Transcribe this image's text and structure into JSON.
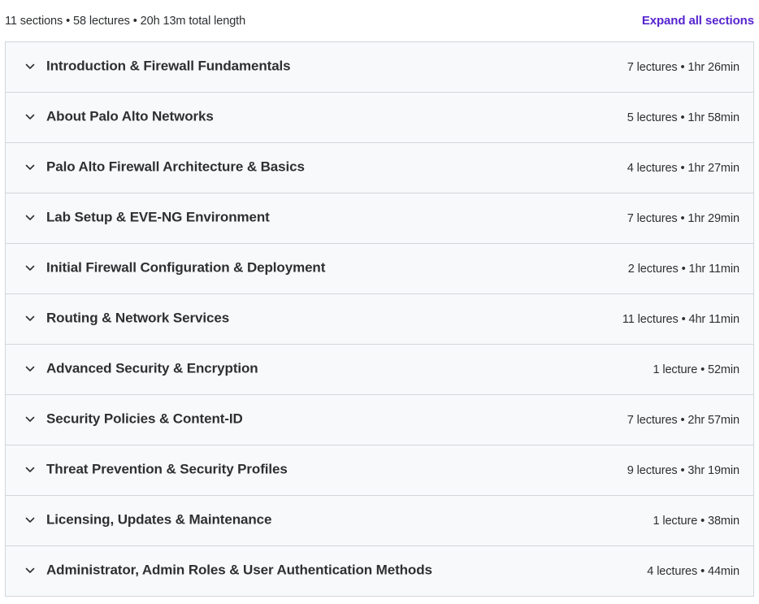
{
  "summary": {
    "text": "11 sections • 58 lectures • 20h 13m total length",
    "expand_all_label": "Expand all sections"
  },
  "colors": {
    "accent": "#5624d0",
    "section_bg": "#f7f9fa",
    "border": "#d1d7dc",
    "text": "#2d2f31"
  },
  "sections": [
    {
      "title": "Introduction & Firewall Fundamentals",
      "meta": "7 lectures • 1hr 26min",
      "icon": "chevron-down-icon"
    },
    {
      "title": "About Palo Alto Networks",
      "meta": "5 lectures • 1hr 58min",
      "icon": "chevron-down-icon"
    },
    {
      "title": "Palo Alto Firewall Architecture & Basics",
      "meta": "4 lectures • 1hr 27min",
      "icon": "chevron-down-icon"
    },
    {
      "title": "Lab Setup & EVE-NG Environment",
      "meta": "7 lectures • 1hr 29min",
      "icon": "chevron-down-icon"
    },
    {
      "title": "Initial Firewall Configuration & Deployment",
      "meta": "2 lectures • 1hr 11min",
      "icon": "chevron-down-icon"
    },
    {
      "title": "Routing & Network Services",
      "meta": "11 lectures • 4hr 11min",
      "icon": "chevron-down-icon"
    },
    {
      "title": "Advanced Security & Encryption",
      "meta": "1 lecture • 52min",
      "icon": "chevron-down-icon"
    },
    {
      "title": "Security Policies & Content-ID",
      "meta": "7 lectures • 2hr 57min",
      "icon": "chevron-down-icon"
    },
    {
      "title": "Threat Prevention & Security Profiles",
      "meta": "9 lectures • 3hr 19min",
      "icon": "chevron-down-icon"
    },
    {
      "title": "Licensing, Updates & Maintenance",
      "meta": "1 lecture • 38min",
      "icon": "chevron-down-icon"
    },
    {
      "title": "Administrator, Admin Roles & User Authentication Methods",
      "meta": "4 lectures • 44min",
      "icon": "chevron-down-icon"
    }
  ]
}
